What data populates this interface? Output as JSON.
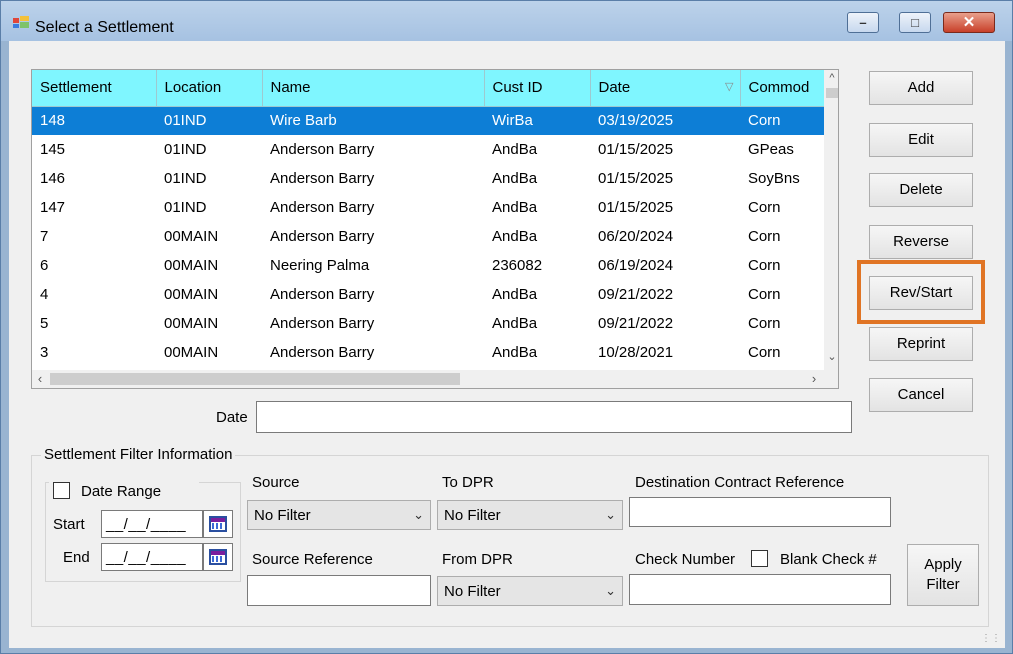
{
  "window": {
    "title": "Select a Settlement",
    "minimize_glyph": "–",
    "maximize_glyph": "□",
    "close_glyph": "✕"
  },
  "grid": {
    "columns": [
      "Settlement",
      "Location",
      "Name",
      "Cust ID",
      "Date",
      "Commod"
    ],
    "sorted_column": "Date",
    "sort_glyph": "▽",
    "selected_row": 0,
    "rows": [
      [
        "148",
        "01IND",
        "Wire Barb",
        "WirBa",
        "03/19/2025",
        "Corn"
      ],
      [
        "145",
        "01IND",
        "Anderson Barry",
        "AndBa",
        "01/15/2025",
        "GPeas"
      ],
      [
        "146",
        "01IND",
        "Anderson Barry",
        "AndBa",
        "01/15/2025",
        "SoyBns"
      ],
      [
        "147",
        "01IND",
        "Anderson Barry",
        "AndBa",
        "01/15/2025",
        "Corn"
      ],
      [
        "7",
        "00MAIN",
        "Anderson Barry",
        "AndBa",
        "06/20/2024",
        "Corn"
      ],
      [
        "6",
        "00MAIN",
        "Neering Palma",
        "236082",
        "06/19/2024",
        "Corn"
      ],
      [
        "4",
        "00MAIN",
        "Anderson Barry",
        "AndBa",
        "09/21/2022",
        "Corn"
      ],
      [
        "5",
        "00MAIN",
        "Anderson Barry",
        "AndBa",
        "09/21/2022",
        "Corn"
      ],
      [
        "3",
        "00MAIN",
        "Anderson Barry",
        "AndBa",
        "10/28/2021",
        "Corn"
      ]
    ]
  },
  "buttons": {
    "add": "Add",
    "edit": "Edit",
    "delete": "Delete",
    "reverse": "Reverse",
    "rev_start": "Rev/Start",
    "reprint": "Reprint",
    "cancel": "Cancel"
  },
  "date_field": {
    "label": "Date",
    "value": ""
  },
  "filter": {
    "legend": "Settlement Filter Information",
    "date_range": {
      "label": "Date Range",
      "checked": false,
      "start_label": "Start",
      "start_value": "__/__/____",
      "end_label": "End",
      "end_value": "__/__/____"
    },
    "source": {
      "label": "Source",
      "value": "No Filter"
    },
    "to_dpr": {
      "label": "To DPR",
      "value": "No Filter"
    },
    "dest_contract_ref": {
      "label": "Destination Contract Reference",
      "value": ""
    },
    "source_reference": {
      "label": "Source Reference",
      "value": ""
    },
    "from_dpr": {
      "label": "From DPR",
      "value": "No Filter"
    },
    "check_number": {
      "label": "Check Number",
      "value": ""
    },
    "blank_check": {
      "label": "Blank Check #",
      "checked": false
    },
    "apply_label_1": "Apply",
    "apply_label_2": "Filter"
  },
  "colors": {
    "header_bg": "#7ff6ff",
    "selected_row_bg": "#0d7ed6",
    "highlight_border": "#e07424"
  }
}
